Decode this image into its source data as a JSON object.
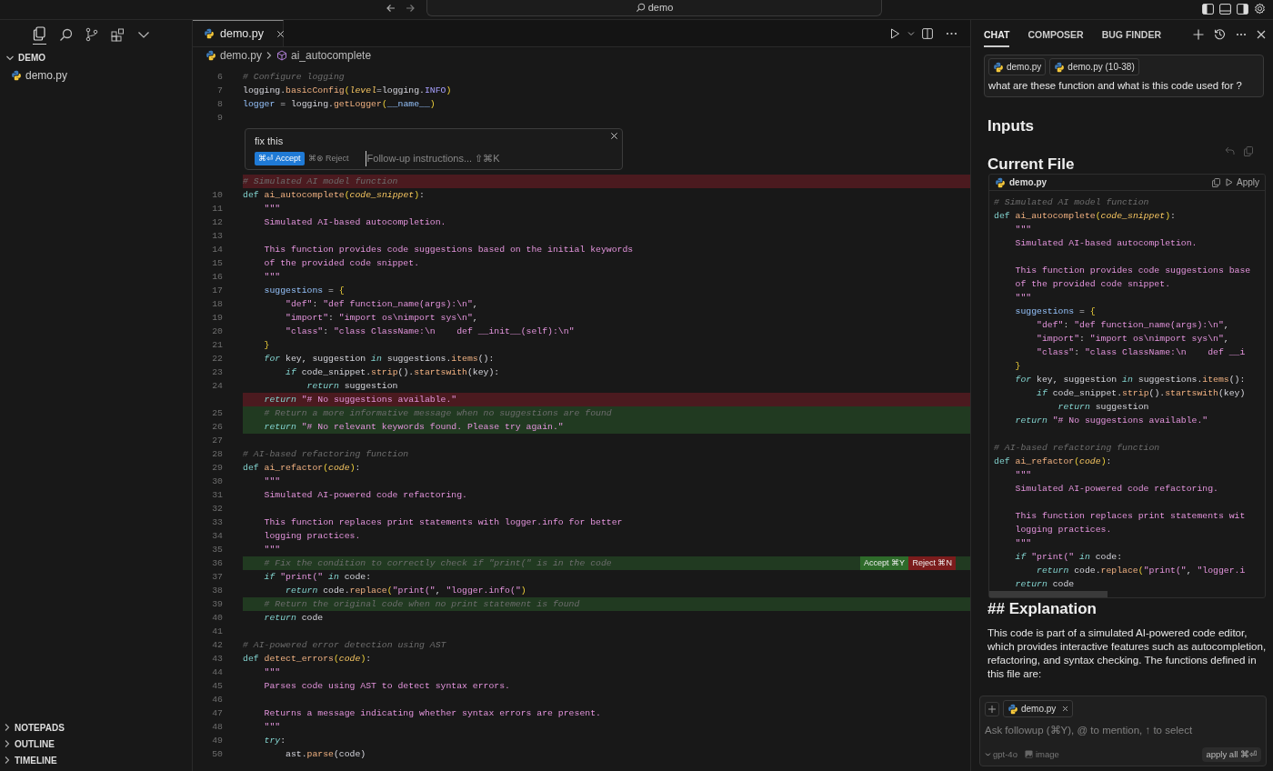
{
  "title_bar": {
    "search": {
      "value": "demo"
    }
  },
  "sidebar": {
    "section": "DEMO",
    "files": [
      {
        "name": "demo.py"
      }
    ],
    "panels": [
      "NOTEPADS",
      "OUTLINE",
      "TIMELINE"
    ]
  },
  "editor": {
    "tabs": [
      {
        "label": "demo.py"
      }
    ],
    "breadcrumb": [
      {
        "kind": "file",
        "label": "demo.py"
      },
      {
        "kind": "symbol",
        "label": "ai_autocomplete"
      }
    ],
    "lines": [
      {
        "kind": "normal",
        "number": "6",
        "tokens": [
          {
            "kind": "comment",
            "text": "# Configure logging"
          }
        ]
      },
      {
        "kind": "normal",
        "number": "7",
        "tokens": [
          {
            "kind": "plain",
            "text": "logging."
          },
          {
            "kind": "function",
            "text": "basicConfig"
          },
          {
            "kind": "bracket",
            "text": "("
          },
          {
            "kind": "parameter",
            "text": "level"
          },
          {
            "kind": "plain",
            "text": "=logging."
          },
          {
            "kind": "constant",
            "text": "INFO"
          },
          {
            "kind": "bracket",
            "text": ")"
          }
        ]
      },
      {
        "kind": "normal",
        "number": "8",
        "tokens": [
          {
            "kind": "variable",
            "text": "logger"
          },
          {
            "kind": "plain",
            "text": " = logging."
          },
          {
            "kind": "function",
            "text": "getLogger"
          },
          {
            "kind": "bracket",
            "text": "("
          },
          {
            "kind": "variable",
            "text": "__name__"
          },
          {
            "kind": "bracket",
            "text": ")"
          }
        ]
      },
      {
        "kind": "normal",
        "number": "9"
      },
      {
        "kind": "prompt",
        "text": "fix this",
        "accept": "⌘⏎ Accept",
        "reject": "⌘⊗ Reject",
        "placeholder": "Follow-up instructions... ⇧⌘K"
      },
      {
        "kind": "deleted",
        "tokens": [
          {
            "kind": "comment",
            "text": "# Simulated AI model function"
          }
        ]
      },
      {
        "kind": "normal",
        "number": "10",
        "tokens": [
          {
            "kind": "keyword",
            "text": "def "
          },
          {
            "kind": "function",
            "text": "ai_autocomplete"
          },
          {
            "kind": "bracket",
            "text": "("
          },
          {
            "kind": "parameter",
            "text": "code_snippet"
          },
          {
            "kind": "bracket",
            "text": ")"
          },
          {
            "kind": "plain",
            "text": ":"
          }
        ]
      },
      {
        "kind": "normal",
        "number": "11",
        "tokens": [
          {
            "kind": "string",
            "text": "    \"\"\""
          }
        ]
      },
      {
        "kind": "normal",
        "number": "12",
        "tokens": [
          {
            "kind": "string",
            "text": "    Simulated AI-based autocompletion."
          }
        ]
      },
      {
        "kind": "normal",
        "number": "13"
      },
      {
        "kind": "normal",
        "number": "14",
        "tokens": [
          {
            "kind": "string",
            "text": "    This function provides code suggestions based on the initial keywords"
          }
        ]
      },
      {
        "kind": "normal",
        "number": "15",
        "tokens": [
          {
            "kind": "string",
            "text": "    of the provided code snippet."
          }
        ]
      },
      {
        "kind": "normal",
        "number": "16",
        "tokens": [
          {
            "kind": "string",
            "text": "    \"\"\""
          }
        ]
      },
      {
        "kind": "normal",
        "number": "17",
        "tokens": [
          {
            "kind": "variable",
            "text": "    suggestions"
          },
          {
            "kind": "plain",
            "text": " = "
          },
          {
            "kind": "bracket",
            "text": "{"
          }
        ]
      },
      {
        "kind": "normal",
        "number": "18",
        "tokens": [
          {
            "kind": "string",
            "text": "        \"def\""
          },
          {
            "kind": "plain",
            "text": ": "
          },
          {
            "kind": "string",
            "text": "\"def function_name(args):\\n\""
          },
          {
            "kind": "plain",
            "text": ","
          }
        ]
      },
      {
        "kind": "normal",
        "number": "19",
        "tokens": [
          {
            "kind": "string",
            "text": "        \"import\""
          },
          {
            "kind": "plain",
            "text": ": "
          },
          {
            "kind": "string",
            "text": "\"import os\\nimport sys\\n\""
          },
          {
            "kind": "plain",
            "text": ","
          }
        ]
      },
      {
        "kind": "normal",
        "number": "20",
        "tokens": [
          {
            "kind": "string",
            "text": "        \"class\""
          },
          {
            "kind": "plain",
            "text": ": "
          },
          {
            "kind": "string",
            "text": "\"class ClassName:\\n    def __init__(self):\\n\""
          }
        ]
      },
      {
        "kind": "normal",
        "number": "21",
        "tokens": [
          {
            "kind": "bracket",
            "text": "    }"
          }
        ]
      },
      {
        "kind": "normal",
        "number": "22",
        "tokens": [
          {
            "kind": "control",
            "text": "    for"
          },
          {
            "kind": "plain",
            "text": " key, suggestion "
          },
          {
            "kind": "control",
            "text": "in"
          },
          {
            "kind": "plain",
            "text": " suggestions."
          },
          {
            "kind": "function",
            "text": "items"
          },
          {
            "kind": "plain",
            "text": "():"
          }
        ]
      },
      {
        "kind": "normal",
        "number": "23",
        "tokens": [
          {
            "kind": "control",
            "text": "        if"
          },
          {
            "kind": "plain",
            "text": " code_snippet."
          },
          {
            "kind": "function",
            "text": "strip"
          },
          {
            "kind": "plain",
            "text": "()."
          },
          {
            "kind": "function",
            "text": "startswith"
          },
          {
            "kind": "plain",
            "text": "(key):"
          }
        ]
      },
      {
        "kind": "normal",
        "number": "24",
        "tokens": [
          {
            "kind": "control",
            "text": "            return"
          },
          {
            "kind": "plain",
            "text": " suggestion"
          }
        ]
      },
      {
        "kind": "deleted",
        "tokens": [
          {
            "kind": "control",
            "text": "    return"
          },
          {
            "kind": "string",
            "text": " \"# No suggestions available.\""
          }
        ]
      },
      {
        "kind": "added",
        "number": "25",
        "tokens": [
          {
            "kind": "comment",
            "text": "    # Return a more informative message when no suggestions are found"
          }
        ]
      },
      {
        "kind": "added",
        "number": "26",
        "tokens": [
          {
            "kind": "control",
            "text": "    return"
          },
          {
            "kind": "string",
            "text": " \"# No relevant keywords found. Please try again.\""
          }
        ]
      },
      {
        "kind": "normal",
        "number": "27"
      },
      {
        "kind": "normal",
        "number": "28",
        "tokens": [
          {
            "kind": "comment",
            "text": "# AI-based refactoring function"
          }
        ]
      },
      {
        "kind": "normal",
        "number": "29",
        "tokens": [
          {
            "kind": "keyword",
            "text": "def "
          },
          {
            "kind": "function",
            "text": "ai_refactor"
          },
          {
            "kind": "bracket",
            "text": "("
          },
          {
            "kind": "parameter",
            "text": "code"
          },
          {
            "kind": "bracket",
            "text": ")"
          },
          {
            "kind": "plain",
            "text": ":"
          }
        ]
      },
      {
        "kind": "normal",
        "number": "30",
        "tokens": [
          {
            "kind": "string",
            "text": "    \"\"\""
          }
        ]
      },
      {
        "kind": "normal",
        "number": "31",
        "tokens": [
          {
            "kind": "string",
            "text": "    Simulated AI-powered code refactoring."
          }
        ]
      },
      {
        "kind": "normal",
        "number": "32"
      },
      {
        "kind": "normal",
        "number": "33",
        "tokens": [
          {
            "kind": "string",
            "text": "    This function replaces print statements with logger.info for better"
          }
        ]
      },
      {
        "kind": "normal",
        "number": "34",
        "tokens": [
          {
            "kind": "string",
            "text": "    logging practices."
          }
        ]
      },
      {
        "kind": "normal",
        "number": "35",
        "tokens": [
          {
            "kind": "string",
            "text": "    \"\"\""
          }
        ]
      },
      {
        "kind": "added",
        "number": "36",
        "tokens": [
          {
            "kind": "comment",
            "text": "    # Fix the condition to correctly check if \"print(\" is in the code"
          }
        ],
        "actions": {
          "accept": "Accept ⌘Y",
          "reject": "Reject ⌘N"
        }
      },
      {
        "kind": "normal",
        "number": "37",
        "tokens": [
          {
            "kind": "control",
            "text": "    if"
          },
          {
            "kind": "string",
            "text": " \"print(\""
          },
          {
            "kind": "control",
            "text": " in"
          },
          {
            "kind": "plain",
            "text": " code:"
          }
        ]
      },
      {
        "kind": "normal",
        "number": "38",
        "tokens": [
          {
            "kind": "control",
            "text": "        return"
          },
          {
            "kind": "plain",
            "text": " code."
          },
          {
            "kind": "function",
            "text": "replace"
          },
          {
            "kind": "bracket",
            "text": "("
          },
          {
            "kind": "string",
            "text": "\"print(\""
          },
          {
            "kind": "plain",
            "text": ", "
          },
          {
            "kind": "string",
            "text": "\"logger.info(\""
          },
          {
            "kind": "bracket",
            "text": ")"
          }
        ]
      },
      {
        "kind": "added",
        "number": "39",
        "tokens": [
          {
            "kind": "comment",
            "text": "    # Return the original code when no print statement is found"
          }
        ]
      },
      {
        "kind": "normal",
        "number": "40",
        "tokens": [
          {
            "kind": "control",
            "text": "    return"
          },
          {
            "kind": "plain",
            "text": " code"
          }
        ]
      },
      {
        "kind": "normal",
        "number": "41"
      },
      {
        "kind": "normal",
        "number": "42",
        "tokens": [
          {
            "kind": "comment",
            "text": "# AI-powered error detection using AST"
          }
        ]
      },
      {
        "kind": "normal",
        "number": "43",
        "tokens": [
          {
            "kind": "keyword",
            "text": "def "
          },
          {
            "kind": "function",
            "text": "detect_errors"
          },
          {
            "kind": "bracket",
            "text": "("
          },
          {
            "kind": "parameter",
            "text": "code"
          },
          {
            "kind": "bracket",
            "text": ")"
          },
          {
            "kind": "plain",
            "text": ":"
          }
        ]
      },
      {
        "kind": "normal",
        "number": "44",
        "tokens": [
          {
            "kind": "string",
            "text": "    \"\"\""
          }
        ]
      },
      {
        "kind": "normal",
        "number": "45",
        "tokens": [
          {
            "kind": "string",
            "text": "    Parses code using AST to detect syntax errors."
          }
        ]
      },
      {
        "kind": "normal",
        "number": "46"
      },
      {
        "kind": "normal",
        "number": "47",
        "tokens": [
          {
            "kind": "string",
            "text": "    Returns a message indicating whether syntax errors are present."
          }
        ]
      },
      {
        "kind": "normal",
        "number": "48",
        "tokens": [
          {
            "kind": "string",
            "text": "    \"\"\""
          }
        ]
      },
      {
        "kind": "normal",
        "number": "49",
        "tokens": [
          {
            "kind": "control",
            "text": "    try"
          },
          {
            "kind": "plain",
            "text": ":"
          }
        ]
      },
      {
        "kind": "normal",
        "number": "50",
        "tokens": [
          {
            "kind": "plain",
            "text": "        ast."
          },
          {
            "kind": "function",
            "text": "parse"
          },
          {
            "kind": "plain",
            "text": "(code)"
          }
        ]
      }
    ]
  },
  "chat": {
    "tabs": [
      {
        "label": "CHAT",
        "selected": true
      },
      {
        "label": "COMPOSER",
        "selected": false
      },
      {
        "label": "BUG FINDER",
        "selected": false
      }
    ],
    "message": {
      "chips": [
        "demo.py",
        "demo.py (10-38)"
      ],
      "text": "what are these function and what is this code used for ?"
    },
    "inputs_heading": "Inputs",
    "current_file_heading": "Current File",
    "code_block": {
      "file": "demo.py",
      "apply": "Apply",
      "groups": [
        {
          "lines": [
            {
              "tokens": [
                {
                  "kind": "comment",
                  "text": "# Simulated AI model function"
                }
              ]
            },
            {
              "tokens": [
                {
                  "kind": "keyword",
                  "text": "def "
                },
                {
                  "kind": "function",
                  "text": "ai_autocomplete"
                },
                {
                  "kind": "bracket",
                  "text": "("
                },
                {
                  "kind": "parameter",
                  "text": "code_snippet"
                },
                {
                  "kind": "bracket",
                  "text": ")"
                },
                {
                  "kind": "plain",
                  "text": ":"
                }
              ]
            },
            {
              "tokens": [
                {
                  "kind": "string",
                  "text": "    \"\"\""
                }
              ]
            },
            {
              "tokens": [
                {
                  "kind": "string",
                  "text": "    Simulated AI-based autocompletion."
                }
              ]
            }
          ]
        },
        {
          "lines": [
            {
              "tokens": [
                {
                  "kind": "string",
                  "text": "    This function provides code suggestions base"
                }
              ]
            },
            {
              "tokens": [
                {
                  "kind": "string",
                  "text": "    of the provided code snippet."
                }
              ]
            },
            {
              "tokens": [
                {
                  "kind": "string",
                  "text": "    \"\"\""
                }
              ]
            },
            {
              "tokens": [
                {
                  "kind": "variable",
                  "text": "    suggestions"
                },
                {
                  "kind": "plain",
                  "text": " = "
                },
                {
                  "kind": "bracket",
                  "text": "{"
                }
              ]
            },
            {
              "tokens": [
                {
                  "kind": "string",
                  "text": "        \"def\""
                },
                {
                  "kind": "plain",
                  "text": ": "
                },
                {
                  "kind": "string",
                  "text": "\"def function_name(args):\\n\""
                },
                {
                  "kind": "plain",
                  "text": ","
                }
              ]
            },
            {
              "tokens": [
                {
                  "kind": "string",
                  "text": "        \"import\""
                },
                {
                  "kind": "plain",
                  "text": ": "
                },
                {
                  "kind": "string",
                  "text": "\"import os\\nimport sys\\n\""
                },
                {
                  "kind": "plain",
                  "text": ","
                }
              ]
            },
            {
              "tokens": [
                {
                  "kind": "string",
                  "text": "        \"class\""
                },
                {
                  "kind": "plain",
                  "text": ": "
                },
                {
                  "kind": "string",
                  "text": "\"class ClassName:\\n    def __i"
                }
              ]
            },
            {
              "tokens": [
                {
                  "kind": "bracket",
                  "text": "    }"
                }
              ]
            },
            {
              "tokens": [
                {
                  "kind": "control",
                  "text": "    for"
                },
                {
                  "kind": "plain",
                  "text": " key, suggestion "
                },
                {
                  "kind": "control",
                  "text": "in"
                },
                {
                  "kind": "plain",
                  "text": " suggestions."
                },
                {
                  "kind": "function",
                  "text": "items"
                },
                {
                  "kind": "plain",
                  "text": "():"
                }
              ]
            },
            {
              "tokens": [
                {
                  "kind": "control",
                  "text": "        if"
                },
                {
                  "kind": "plain",
                  "text": " code_snippet."
                },
                {
                  "kind": "function",
                  "text": "strip"
                },
                {
                  "kind": "plain",
                  "text": "()."
                },
                {
                  "kind": "function",
                  "text": "startswith"
                },
                {
                  "kind": "plain",
                  "text": "(key)"
                }
              ]
            },
            {
              "tokens": [
                {
                  "kind": "control",
                  "text": "            return"
                },
                {
                  "kind": "plain",
                  "text": " suggestion"
                }
              ]
            },
            {
              "tokens": [
                {
                  "kind": "control",
                  "text": "    return"
                },
                {
                  "kind": "string",
                  "text": " \"# No suggestions available.\""
                }
              ]
            }
          ]
        },
        {
          "lines": [
            {
              "tokens": [
                {
                  "kind": "comment",
                  "text": "# AI-based refactoring function"
                }
              ]
            },
            {
              "tokens": [
                {
                  "kind": "keyword",
                  "text": "def "
                },
                {
                  "kind": "function",
                  "text": "ai_refactor"
                },
                {
                  "kind": "bracket",
                  "text": "("
                },
                {
                  "kind": "parameter",
                  "text": "code"
                },
                {
                  "kind": "bracket",
                  "text": ")"
                },
                {
                  "kind": "plain",
                  "text": ":"
                }
              ]
            },
            {
              "tokens": [
                {
                  "kind": "string",
                  "text": "    \"\"\""
                }
              ]
            },
            {
              "tokens": [
                {
                  "kind": "string",
                  "text": "    Simulated AI-powered code refactoring."
                }
              ]
            }
          ]
        },
        {
          "lines": [
            {
              "tokens": [
                {
                  "kind": "string",
                  "text": "    This function replaces print statements wit"
                }
              ]
            },
            {
              "tokens": [
                {
                  "kind": "string",
                  "text": "    logging practices."
                }
              ]
            },
            {
              "tokens": [
                {
                  "kind": "string",
                  "text": "    \"\"\""
                }
              ]
            },
            {
              "tokens": [
                {
                  "kind": "control",
                  "text": "    if"
                },
                {
                  "kind": "string",
                  "text": " \"print(\""
                },
                {
                  "kind": "control",
                  "text": " in"
                },
                {
                  "kind": "plain",
                  "text": " code:"
                }
              ]
            },
            {
              "tokens": [
                {
                  "kind": "control",
                  "text": "        return"
                },
                {
                  "kind": "plain",
                  "text": " code."
                },
                {
                  "kind": "function",
                  "text": "replace"
                },
                {
                  "kind": "bracket",
                  "text": "("
                },
                {
                  "kind": "string",
                  "text": "\"print(\""
                },
                {
                  "kind": "plain",
                  "text": ", "
                },
                {
                  "kind": "string",
                  "text": "\"logger.i"
                }
              ]
            },
            {
              "tokens": [
                {
                  "kind": "control",
                  "text": "    return"
                },
                {
                  "kind": "plain",
                  "text": " code"
                }
              ]
            }
          ]
        }
      ]
    },
    "explanation_heading": "## Explanation",
    "explanation": "This code is part of a simulated AI-powered code editor, which provides interactive features such as autocompletion, refactoring, and syntax checking. The functions defined in this file are:",
    "composer": {
      "chip": "demo.py",
      "placeholder": "Ask followup (⌘Y), @ to mention, ↑ to select",
      "model": "gpt-4o",
      "image": "image",
      "apply_all": "apply all ⌘⏎"
    }
  }
}
